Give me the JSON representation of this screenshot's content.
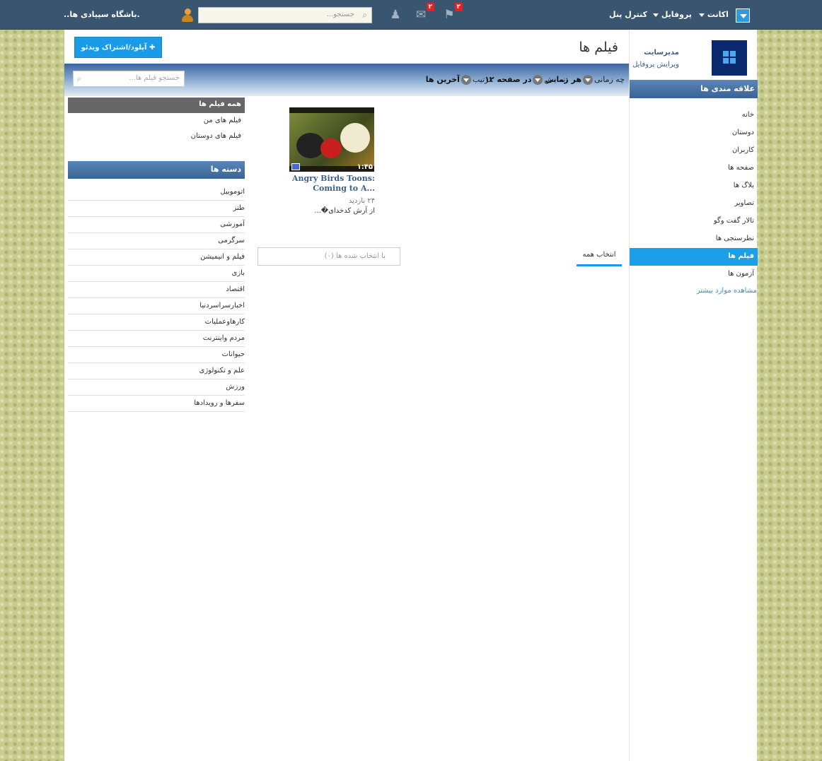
{
  "topbar": {
    "site_name": ".باشگاه سپیادی ها..",
    "search_placeholder": "جستجو...",
    "nav": {
      "account": "اکانت",
      "profile": "پروفایل",
      "control_panel": "کنترل پنل"
    },
    "mail_badge": "۲",
    "notify_badge": "۲"
  },
  "profile": {
    "name": "مدیرسایت",
    "edit": "ویرایش پروفایل"
  },
  "sidebar": {
    "header": "علاقه مندی ها",
    "items": [
      {
        "label": "خانه"
      },
      {
        "label": "دوستان"
      },
      {
        "label": "کاربران"
      },
      {
        "label": "صفحه ها"
      },
      {
        "label": "بلاگ ها"
      },
      {
        "label": "تصاویر"
      },
      {
        "label": "تالار گفت وگو"
      },
      {
        "label": "نظرسنجی ها"
      },
      {
        "label": "فیلم ها"
      },
      {
        "label": "آزمون ها"
      }
    ],
    "more": "مشاهده موارد بیشتر"
  },
  "main": {
    "title": "فیلم ها",
    "upload_button": "آپلود/اشتراک ویدئو"
  },
  "filters": {
    "search_placeholder": "جستجو فیلم ها...",
    "when_label": "چه زمانی",
    "when_value": "هر زمانی",
    "show_label": ":نمایش",
    "show_value": "در صفحه ۱۲",
    "sort_label": ":ترتیب",
    "sort_value": "آخرین ها"
  },
  "my_videos": {
    "header": "همه فیلم ها",
    "items": [
      {
        "label": "فیلم های من"
      },
      {
        "label": "فیلم های دوستان"
      }
    ]
  },
  "categories": {
    "header": "دسته ها",
    "items": [
      {
        "label": "اتوموبیل"
      },
      {
        "label": "طنز"
      },
      {
        "label": "آموزشی"
      },
      {
        "label": "سرگرمی"
      },
      {
        "label": "فیلم و انیمیشن"
      },
      {
        "label": "بازی"
      },
      {
        "label": "اقتصاد"
      },
      {
        "label": "اخبارسراسردنیا"
      },
      {
        "label": "کارهاوعملیات"
      },
      {
        "label": "مردم واینترنت"
      },
      {
        "label": "حیوانات"
      },
      {
        "label": "علم و تکنولوژی"
      },
      {
        "label": "ورزش"
      },
      {
        "label": "سفرها و رویدادها"
      }
    ]
  },
  "video": {
    "duration": "۱:۴۵",
    "title": "Angry Birds Toons: Coming to A...",
    "views": "۲۴ بازدید",
    "author": "از آرش کدخدای�..."
  },
  "selection": {
    "select_all": "انتخاب همه",
    "selected": "با انتخاب شده ها (۰)"
  }
}
